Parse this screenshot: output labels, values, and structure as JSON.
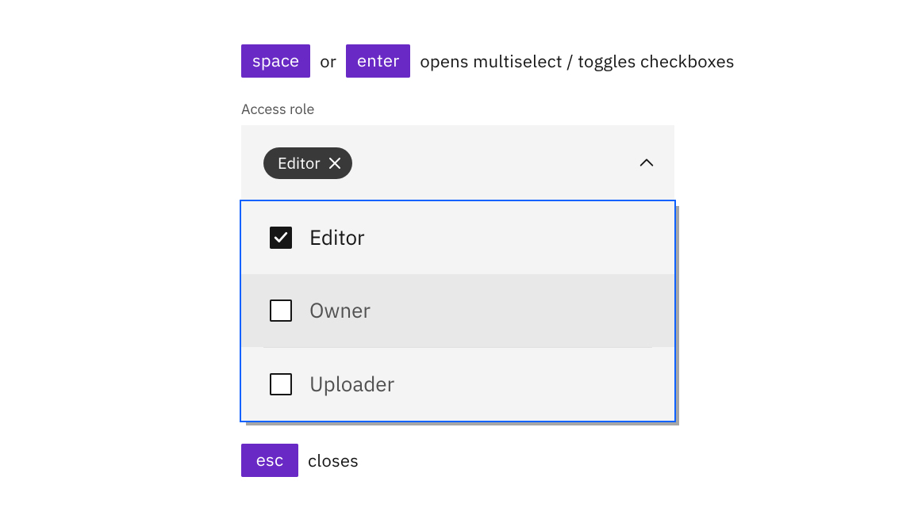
{
  "hints": {
    "top": {
      "key1": "space",
      "connector": "or",
      "key2": "enter",
      "text": "opens multiselect / toggles checkboxes"
    },
    "bottom": {
      "key": "esc",
      "text": "closes"
    }
  },
  "field": {
    "label": "Access role",
    "selected_tag": "Editor"
  },
  "options": [
    {
      "label": "Editor",
      "checked": true,
      "hovered": false
    },
    {
      "label": "Owner",
      "checked": false,
      "hovered": true
    },
    {
      "label": "Uploader",
      "checked": false,
      "hovered": false
    }
  ]
}
